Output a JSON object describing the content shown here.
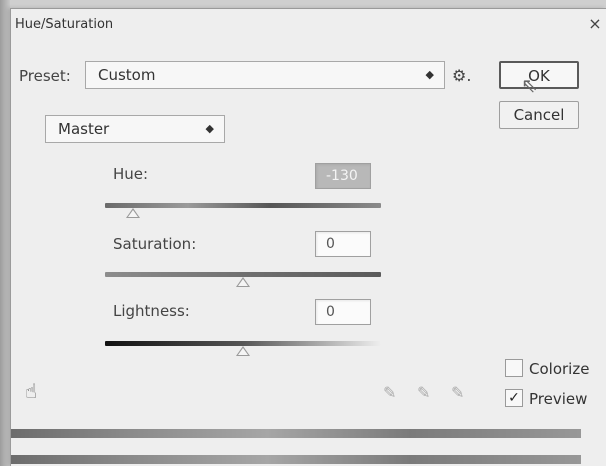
{
  "window": {
    "title": "Hue/Saturation",
    "close_glyph": "×"
  },
  "preset": {
    "label": "Preset:",
    "value": "Custom"
  },
  "channel": {
    "value": "Master"
  },
  "buttons": {
    "ok": "OK",
    "cancel": "Cancel"
  },
  "hue": {
    "label": "Hue:",
    "value": "-130",
    "slider_level": 0.1
  },
  "saturation": {
    "label": "Saturation:",
    "value": "0",
    "slider_level": 0.5
  },
  "lightness": {
    "label": "Lightness:",
    "value": "0",
    "slider_level": 0.5
  },
  "options": {
    "colorize_label": "Colorize",
    "colorize_checked": false,
    "preview_label": "Preview",
    "preview_checked": true
  },
  "icons": [
    "gear-icon",
    "hand-adjust-icon",
    "eyedropper-icon",
    "eyedropper-plus-icon",
    "eyedropper-minus-icon"
  ]
}
